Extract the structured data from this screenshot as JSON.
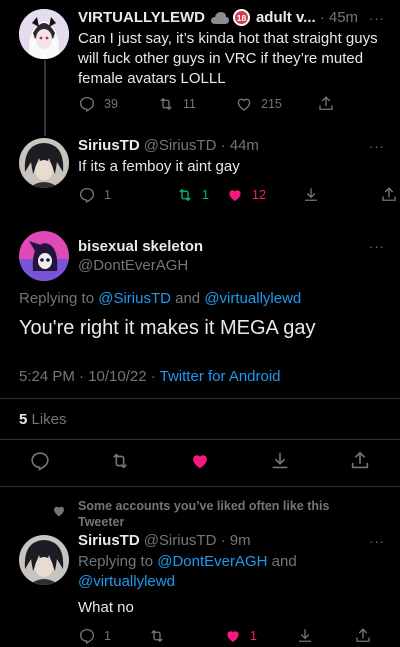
{
  "tweet1": {
    "name": "VIRTUALLYLEWD",
    "badge1": "cloud-icon",
    "badge2": "18",
    "handle": "adult v...",
    "time": "· 45m",
    "more": "···",
    "text": "Can I just say, it’s kinda hot that straight guys will fuck other guys in VRC if they’re muted female avatars LOLLL",
    "replies": "39",
    "retweets": "11",
    "likes": "215"
  },
  "tweet2": {
    "name": "SiriusTD",
    "handle": "@SiriusTD · 44m",
    "more": "···",
    "text": "If its a femboy it aint gay",
    "replies": "1",
    "retweets": "1",
    "likes": "12"
  },
  "main": {
    "name": "bisexual skeleton",
    "handle": "@DontEverAGH",
    "more": "···",
    "replying_prefix": "Replying to ",
    "replying_user1": "@SiriusTD",
    "replying_and": " and ",
    "replying_user2": "@virtuallylewd",
    "text": "You're right it makes it MEGA gay",
    "timestamp": "5:24 PM · 10/10/22 · ",
    "source": "Twitter for Android",
    "likes_count": "5",
    "likes_label": " Likes"
  },
  "reply": {
    "social_context": "Some accounts you’ve liked often like this Tweeter",
    "name": "SiriusTD",
    "handle": "@SiriusTD · 9m",
    "more": "···",
    "replying_prefix": "Replying to ",
    "replying_user1": "@DontEverAGH",
    "replying_and": " and ",
    "replying_user2": "@virtuallylewd",
    "text": "What no",
    "replies": "1",
    "likes": "1"
  },
  "colors": {
    "accent": "#1d9bf0",
    "like_active": "#f91880",
    "retweet_active": "#00ba7c"
  }
}
